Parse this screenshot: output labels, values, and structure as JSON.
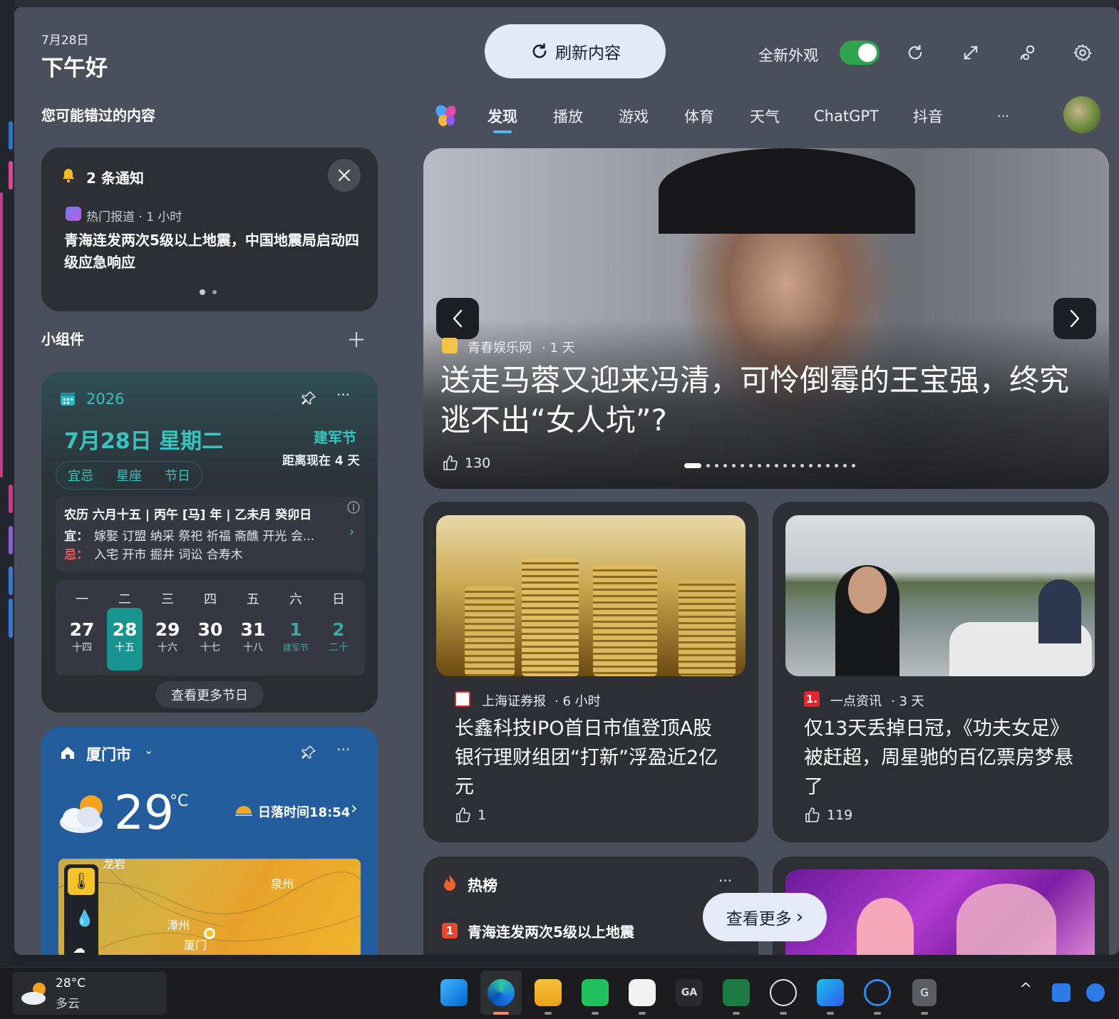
{
  "header": {
    "date": "7月28日",
    "greeting": "下午好",
    "refresh_label": "刷新内容",
    "new_look_label": "全新外观",
    "new_look_enabled": true
  },
  "missed_label": "您可能错过的内容",
  "tabs": [
    "发现",
    "播放",
    "游戏",
    "体育",
    "天气",
    "ChatGPT",
    "抖音",
    "···"
  ],
  "active_tab": "发现",
  "notification": {
    "title": "2 条通知",
    "source": "热门报道 · 1 小时",
    "headline": "青海连发两次5级以上地震，中国地震局启动四级应急响应"
  },
  "widgets_label": "小组件",
  "calendar": {
    "year": "2026",
    "date": "7月28日 星期二",
    "holiday": "建军节",
    "countdown": "距离现在 4 天",
    "segments": [
      "宜忌",
      "星座",
      "节日"
    ],
    "lunar": "农历 六月十五 | 丙午 [马] 年 | 乙未月 癸卯日",
    "yi_label": "宜：",
    "yi": "嫁娶 订盟 纳采 祭祀 祈福 斋醮 开光 会...",
    "ji_label": "忌：",
    "ji": "入宅 开市 掘井 词讼 合寿木",
    "weekdays": [
      "一",
      "二",
      "三",
      "四",
      "五",
      "六",
      "日"
    ],
    "days": [
      {
        "n": "27",
        "l": "十四"
      },
      {
        "n": "28",
        "l": "十五"
      },
      {
        "n": "29",
        "l": "十六"
      },
      {
        "n": "30",
        "l": "十七"
      },
      {
        "n": "31",
        "l": "十八"
      },
      {
        "n": "1",
        "l": "建军节"
      },
      {
        "n": "2",
        "l": "二十"
      }
    ],
    "more_label": "查看更多节日"
  },
  "weather_widget": {
    "city": "厦门市",
    "temp": "29",
    "unit": "°C",
    "sunset": "日落时间18:54",
    "map_labels": [
      "泉州",
      "漳州",
      "厦门",
      "龙岩"
    ]
  },
  "hero": {
    "source": "青春娱乐网",
    "time": "· 1 天",
    "title": "送走马蓉又迎来冯清，可怜倒霉的王宝强，终究逃不出“女人坑”?",
    "likes": "130",
    "slide_count": "19"
  },
  "news": [
    {
      "source": "上海证券报",
      "time": "· 6 小时",
      "title": "长鑫科技IPO首日市值登顶A股 银行理财组团“打新”浮盈近2亿元",
      "likes": "1"
    },
    {
      "source": "一点资讯",
      "time": "· 3 天",
      "title": "仅13天丢掉日冠，《功夫女足》被赶超，周星驰的百亿票房梦悬了",
      "likes": "119"
    }
  ],
  "hot": {
    "title": "热榜",
    "item_rank": "1",
    "item": "青海连发两次5级以上地震",
    "see_more": "查看更多",
    "menu": "···"
  },
  "taskbar": {
    "temp": "28°C",
    "cond": "多云",
    "icons": [
      "start-icon",
      "edge-beta-icon",
      "file-explorer-icon",
      "wechat-icon",
      "app-icon",
      "ga-icon",
      "excel-icon",
      "chatgpt-icon",
      "app-blue-icon",
      "search-app-icon",
      "g-icon"
    ]
  }
}
